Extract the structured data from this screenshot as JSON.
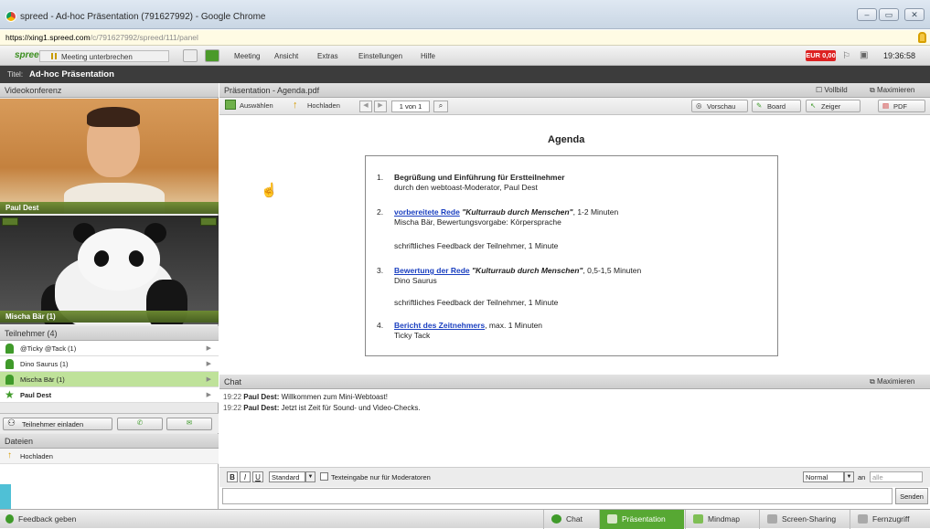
{
  "window": {
    "title": "spreed - Ad-hoc Präsentation (791627992) - Google Chrome"
  },
  "url": {
    "host": "https://xing1.spreed.com",
    "path": "/c/791627992/spreed/111/panel"
  },
  "menubar": {
    "logo": "spreed",
    "pause_label": "Meeting unterbrechen",
    "items": [
      "Meeting",
      "Ansicht",
      "Extras",
      "Einstellungen",
      "Hilfe"
    ],
    "balance": "EUR 0,00",
    "clock": "19:36:58"
  },
  "titlebar": {
    "label": "Titel:",
    "value": "Ad-hoc Präsentation"
  },
  "left": {
    "video_header": "Videokonferenz",
    "video1_name": "Paul Dest",
    "video2_name": "Mischa Bär (1)",
    "participants_header": "Teilnehmer (4)",
    "participants": [
      "@Ticky @Tack (1)",
      "Dino Saurus (1)",
      "Mischa Bär (1)",
      "Paul Dest"
    ],
    "invite_label": "Teilnehmer einladen",
    "files_header": "Dateien",
    "upload_label": "Hochladen"
  },
  "presentation": {
    "header": "Präsentation - Agenda.pdf",
    "fullscreen": "Vollbild",
    "maximize": "Maximieren",
    "select": "Auswählen",
    "upload": "Hochladen",
    "page": "1 von 1",
    "preview": "Vorschau",
    "board": "Board",
    "pointer": "Zeiger",
    "pdf": "PDF"
  },
  "agenda": {
    "title": "Agenda",
    "i1_line1": "Begrüßung und Einführung für Erstteilnehmer",
    "i1_line2": "durch den webtoast-Moderator, Paul Dest",
    "i2_link": "vorbereitete Rede",
    "i2_bold": "\"Kulturraub durch Menschen\"",
    "i2_rest": ", 1-2 Minuten",
    "i2_line2": "Mischa Bär, Bewertungsvorgabe: Körpersprache",
    "i2_feedback": "schriftliches Feedback der Teilnehmer, 1 Minute",
    "i3_link": "Bewertung der Rede",
    "i3_bold": "\"Kulturraub durch Menschen\"",
    "i3_rest": ", 0,5-1,5 Minuten",
    "i3_line2": "Dino Saurus",
    "i3_feedback": "schriftliches Feedback der Teilnehmer, 1 Minute",
    "i4_link": "Bericht des Zeitnehmers",
    "i4_rest": ", max. 1 Minuten",
    "i4_line2": "Ticky Tack"
  },
  "chat": {
    "header": "Chat",
    "maximize": "Maximieren",
    "messages": [
      {
        "time": "19:22",
        "author": "Paul Dest:",
        "text": "Willkommen zum Mini-Webtoast!"
      },
      {
        "time": "19:22",
        "author": "Paul Dest:",
        "text": "Jetzt ist Zeit für Sound- und Video-Checks."
      }
    ],
    "style": "Standard",
    "moderators_only": "Texteingabe nur für Moderatoren",
    "priority": "Normal",
    "to_label": "an",
    "to_value": "alle",
    "send": "Senden"
  },
  "bottom": {
    "feedback": "Feedback geben",
    "tabs": [
      "Chat",
      "Präsentation",
      "Mindmap",
      "Screen-Sharing",
      "Fernzugriff"
    ]
  }
}
